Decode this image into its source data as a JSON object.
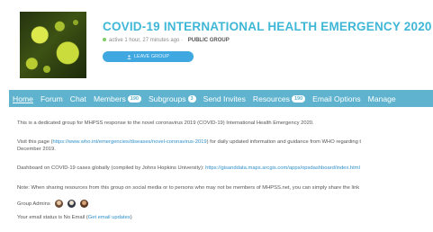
{
  "group": {
    "title": "COVID-19 INTERNATIONAL HEALTH EMERGENCY 2020",
    "active_text": "active 1 hour, 27 minutes ago",
    "separator": "·",
    "type": "PUBLIC GROUP",
    "leave_label": "LEAVE GROUP"
  },
  "nav": {
    "items": [
      {
        "label": "Home"
      },
      {
        "label": "Forum"
      },
      {
        "label": "Chat"
      },
      {
        "label": "Members",
        "badge": "190"
      },
      {
        "label": "Subgroups",
        "badge": "3"
      },
      {
        "label": "Send Invites"
      },
      {
        "label": "Resources",
        "badge": "190"
      },
      {
        "label": "Email Options"
      },
      {
        "label": "Manage"
      }
    ]
  },
  "content": {
    "intro": "This is a dedicated group for MHPSS response to the novel coronavirus 2019 (COVID-19) International Health Emergency 2020.",
    "visit_prefix": "Visit this page (",
    "who_link": "https://www.who.int/emergencies/diseases/novel-coronavirus-2019",
    "visit_suffix": ") for daily updated information and guidance from WHO regarding t",
    "visit_line2": "December 2019.",
    "dashboard_prefix": "Dashboard on COVID-19 cases globally (compiled by Johns Hopkins University): ",
    "dashboard_link": "https://gisanddata.maps.arcgis.com/apps/opsdashboard/index.html",
    "note": "Note: When sharing resources from this group on social media or to persons who may not be members of MHPSS.net, you can simply share the link",
    "admins_label": "Group Admins",
    "email_prefix": "Your email status is No Email (",
    "email_link": "Get email updates",
    "email_suffix": ")"
  },
  "colors": {
    "accent": "#3fb7d6",
    "nav_bg": "#5fb3ce",
    "button": "#3fa8e0",
    "link": "#2f8fc9"
  }
}
